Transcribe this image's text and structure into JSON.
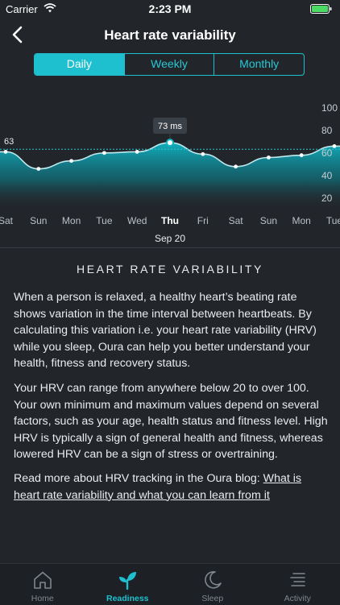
{
  "status_bar": {
    "carrier": "Carrier",
    "time": "2:23 PM"
  },
  "header": {
    "title": "Heart rate variability"
  },
  "period_tabs": [
    {
      "label": "Daily",
      "active": true
    },
    {
      "label": "Weekly",
      "active": false
    },
    {
      "label": "Monthly",
      "active": false
    }
  ],
  "chart_data": {
    "type": "area",
    "x": [
      "Sat",
      "Sun",
      "Mon",
      "Tue",
      "Wed",
      "Thu",
      "Fri",
      "Sat",
      "Sun",
      "Mon",
      "Tue"
    ],
    "values": [
      60,
      45,
      52,
      59,
      60,
      68,
      58,
      47,
      55,
      57,
      65
    ],
    "highlight": {
      "label": "Thu",
      "date": "Sep 20",
      "tooltip": "73 ms"
    },
    "reference": {
      "label": "63",
      "value": 63
    },
    "y_ticks": [
      "100",
      "80",
      "60",
      "40",
      "20"
    ],
    "ylim": [
      10,
      100
    ],
    "colors": {
      "line": "#bfe9ef",
      "fill": "#11b4c3",
      "reference": "#27c8d6"
    }
  },
  "info": {
    "title": "HEART RATE VARIABILITY",
    "paragraph1": "When a person is relaxed, a healthy heart’s beating rate shows variation in the time interval between heartbeats. By calculating this variation i.e. your heart rate variability (HRV) while you sleep, Oura can help you better understand your health, fitness and recovery status.",
    "paragraph2": "Your HRV can range from anywhere below 20 to over 100. Your own minimum and maximum values depend on several factors, such as your age, health status and fitness level. High HRV is typically a sign of general health and fitness, whereas lowered HRV can be a sign of stress or overtraining.",
    "paragraph3_prefix": "Read more about HRV tracking in the Oura blog: ",
    "paragraph3_link": "What is heart rate variability and what you can learn from it"
  },
  "tab_bar": [
    {
      "label": "Home",
      "icon": "home-icon",
      "active": false
    },
    {
      "label": "Readiness",
      "icon": "sprout-icon",
      "active": true
    },
    {
      "label": "Sleep",
      "icon": "moon-icon",
      "active": false
    },
    {
      "label": "Activity",
      "icon": "activity-list-icon",
      "active": false
    }
  ],
  "accent_color": "#1ec0cf"
}
